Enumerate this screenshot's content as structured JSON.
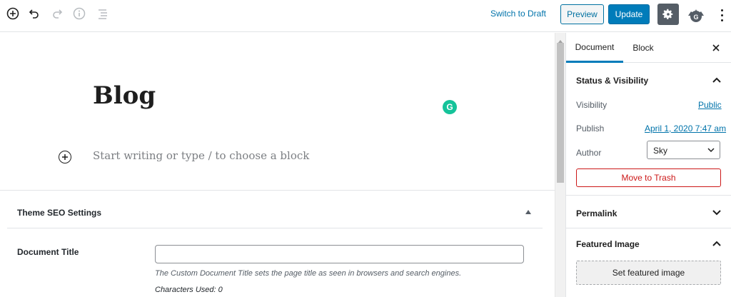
{
  "toolbar": {
    "icons": [
      "add-block-icon",
      "undo-icon",
      "redo-icon",
      "info-icon",
      "outline-icon",
      "gear-icon",
      "user-avatar",
      "more-vertical-icon"
    ],
    "switch_to_draft": "Switch to Draft",
    "preview_label": "Preview",
    "update_label": "Update",
    "avatar_letter": "G"
  },
  "editor": {
    "post_title": "Blog",
    "grammarly_letter": "G",
    "block_placeholder": "Start writing or type / to choose a block"
  },
  "metabox": {
    "title": "Theme SEO Settings",
    "document_title_label": "Document Title",
    "document_title_value": "",
    "document_title_help": "The Custom Document Title sets the page title as seen in browsers and search engines.",
    "characters_used": "Characters Used: 0"
  },
  "sidebar": {
    "tabs": [
      {
        "label": "Document",
        "active": true
      },
      {
        "label": "Block",
        "active": false
      }
    ],
    "status_visibility": {
      "title": "Status & Visibility",
      "visibility_label": "Visibility",
      "visibility_value": "Public",
      "publish_label": "Publish",
      "publish_value": "April 1, 2020 7:47 am",
      "author_label": "Author",
      "author_value": "Sky",
      "trash_label": "Move to Trash"
    },
    "permalink": {
      "title": "Permalink"
    },
    "featured_image": {
      "title": "Featured Image",
      "button_label": "Set featured image"
    }
  },
  "colors": {
    "accent": "#007cba",
    "link": "#0073aa",
    "danger": "#cc1818",
    "grammarly": "#15c39a",
    "settings_bg": "#555d66"
  }
}
